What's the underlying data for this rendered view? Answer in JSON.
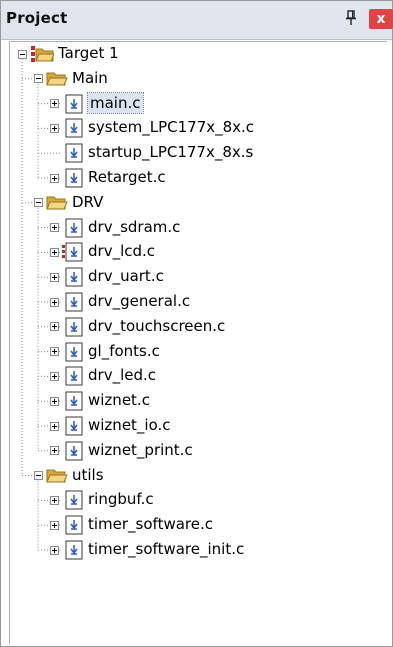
{
  "panel": {
    "title": "Project",
    "close_label": "x"
  },
  "tree": {
    "root": {
      "label": "Target 1"
    },
    "groups": [
      {
        "label": "Main",
        "files": [
          {
            "label": "main.c",
            "expandable": true,
            "selected": true
          },
          {
            "label": "system_LPC177x_8x.c",
            "expandable": true
          },
          {
            "label": "startup_LPC177x_8x.s",
            "expandable": false
          },
          {
            "label": "Retarget.c",
            "expandable": true
          }
        ]
      },
      {
        "label": "DRV",
        "files": [
          {
            "label": "drv_sdram.c",
            "expandable": true
          },
          {
            "label": "drv_lcd.c",
            "expandable": true,
            "marked": true
          },
          {
            "label": "drv_uart.c",
            "expandable": true
          },
          {
            "label": "drv_general.c",
            "expandable": true
          },
          {
            "label": "drv_touchscreen.c",
            "expandable": true
          },
          {
            "label": "gl_fonts.c",
            "expandable": true
          },
          {
            "label": "drv_led.c",
            "expandable": true
          },
          {
            "label": "wiznet.c",
            "expandable": true
          },
          {
            "label": "wiznet_io.c",
            "expandable": true
          },
          {
            "label": "wiznet_print.c",
            "expandable": true
          }
        ]
      },
      {
        "label": "utils",
        "files": [
          {
            "label": "ringbuf.c",
            "expandable": true
          },
          {
            "label": "timer_software.c",
            "expandable": true
          },
          {
            "label": "timer_software_init.c",
            "expandable": true
          }
        ]
      }
    ]
  },
  "colors": {
    "titlebar": "#dfe6ee",
    "close": "#e04343",
    "folder": "#e8c35a",
    "target_red": "#c0282f"
  }
}
